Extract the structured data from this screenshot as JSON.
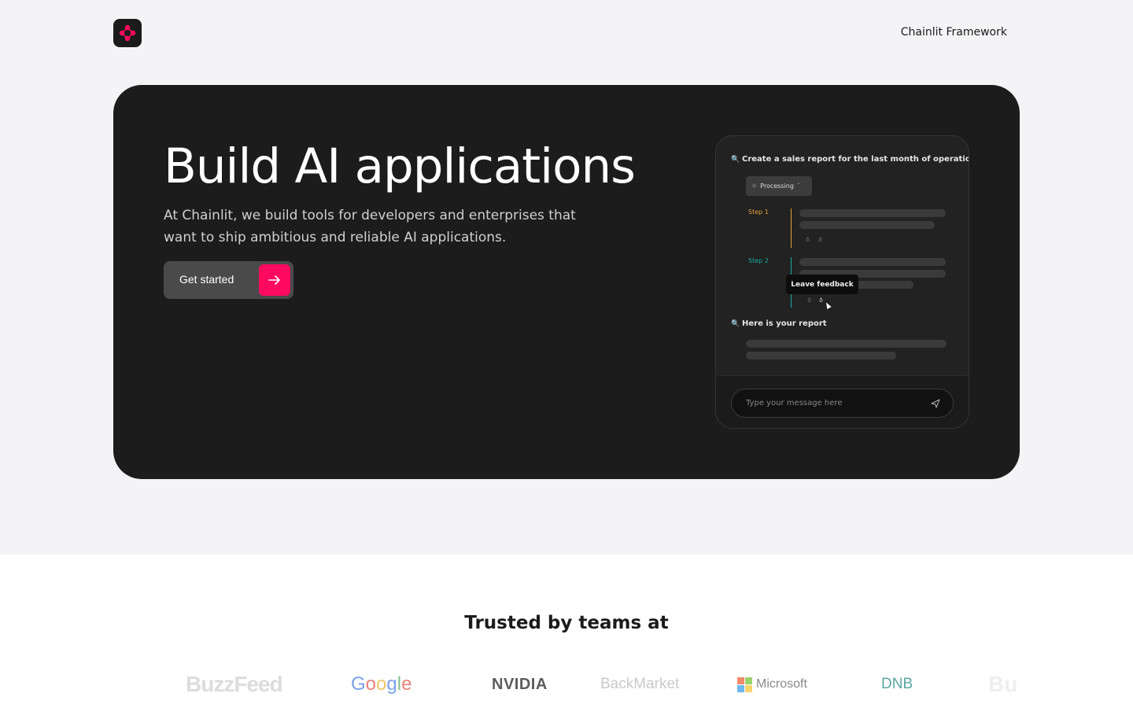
{
  "header": {
    "logo_alt": "Chainlit",
    "nav_link": "Chainlit Framework"
  },
  "hero": {
    "title": "Build AI applications",
    "subtitle": "At Chainlit, we build tools for developers and enterprises that want to ship ambitious and reliable AI applications.",
    "cta_label": "Get started"
  },
  "preview": {
    "user_message": "Create a sales report for the last month of operations.",
    "status_chip": "Processing",
    "step1_label": "Step 1",
    "step2_label": "Step 2",
    "tooltip": "Leave feedback",
    "reply": "Here is your report",
    "input_placeholder": "Type your message here",
    "step1_color": "#e3a13b",
    "step2_color": "#18a9a0"
  },
  "trusted": {
    "heading": "Trusted by teams at",
    "brands": [
      "BuzzFeed",
      "Google",
      "NVIDIA",
      "BackMarket",
      "Microsoft",
      "DNB",
      "Bu"
    ]
  },
  "colors": {
    "accent": "#ff0a5f",
    "hero_bg": "#1c1c1c",
    "page_bg": "#f4f4f6"
  }
}
